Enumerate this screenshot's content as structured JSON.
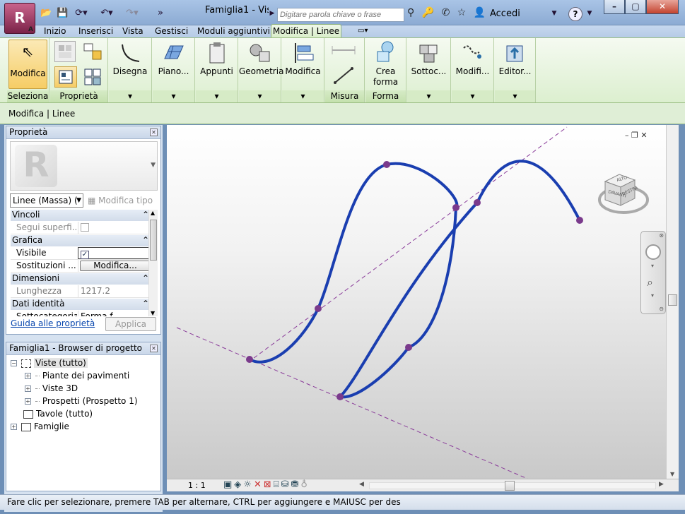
{
  "app": {
    "title": "Famiglia1 - Vis...",
    "logo_letter": "R",
    "logo_sub": "A",
    "search_placeholder": "Digitare parola chiave o frase",
    "signin": "Accedi",
    "help": "?"
  },
  "tabs": [
    "Inizio",
    "Inserisci",
    "Vista",
    "Gestisci",
    "Moduli aggiuntivi"
  ],
  "active_tab": "Modifica | Linee",
  "ribbon": {
    "modify": "Modifica",
    "seleziona": "Seleziona",
    "proprieta": "Proprietà",
    "disegna": "Disegna",
    "piano": "Piano...",
    "appunti": "Appunti",
    "geometria": "Geometria",
    "modifica2": "Modifica",
    "misura": "Misura",
    "crea_forma_1": "Crea",
    "crea_forma_2": "forma",
    "forma": "Forma",
    "sottoc": "Sottoc...",
    "modifi": "Modifi...",
    "editor": "Editor..."
  },
  "context_label": "Modifica | Linee",
  "properties": {
    "title": "Proprietà",
    "type_selector": "Linee (Massa) (",
    "edit_type": "Modifica tipo",
    "groups": {
      "vincoli": "Vincoli",
      "grafica": "Grafica",
      "dimensioni": "Dimensioni",
      "dati": "Dati identità"
    },
    "rows": {
      "segui": "Segui superfi...",
      "visibile": "Visibile",
      "sostituzioni": "Sostituzioni ...",
      "sostituzioni_btn": "Modifica...",
      "lunghezza": "Lunghezza",
      "lunghezza_val": "1217.2",
      "sotto": "Sottocategoria",
      "sotto_val": "Forma f..."
    },
    "help_link": "Guida alle proprietà",
    "apply": "Applica"
  },
  "browser": {
    "title": "Famiglia1 - Browser di progetto",
    "items": {
      "viste": "Viste (tutto)",
      "piante": "Piante dei pavimenti",
      "viste3d": "Viste 3D",
      "prospetti": "Prospetti (Prospetto 1)",
      "tavole": "Tavole (tutto)",
      "famiglie": "Famiglie"
    }
  },
  "viewcube": {
    "top": "ALTO",
    "front": "DAVANTI",
    "right": "DESTRA"
  },
  "view_scale": "1 : 1",
  "status": "Fare clic per selezionare, premere TAB per alternare, CTRL per aggiungere e MAIUSC per des",
  "colors": {
    "curve": "#1a3eb0",
    "points": "#7a3a8c",
    "ref_lines": "#8a3c9a",
    "ribbon_bg": "#e4f2da"
  }
}
